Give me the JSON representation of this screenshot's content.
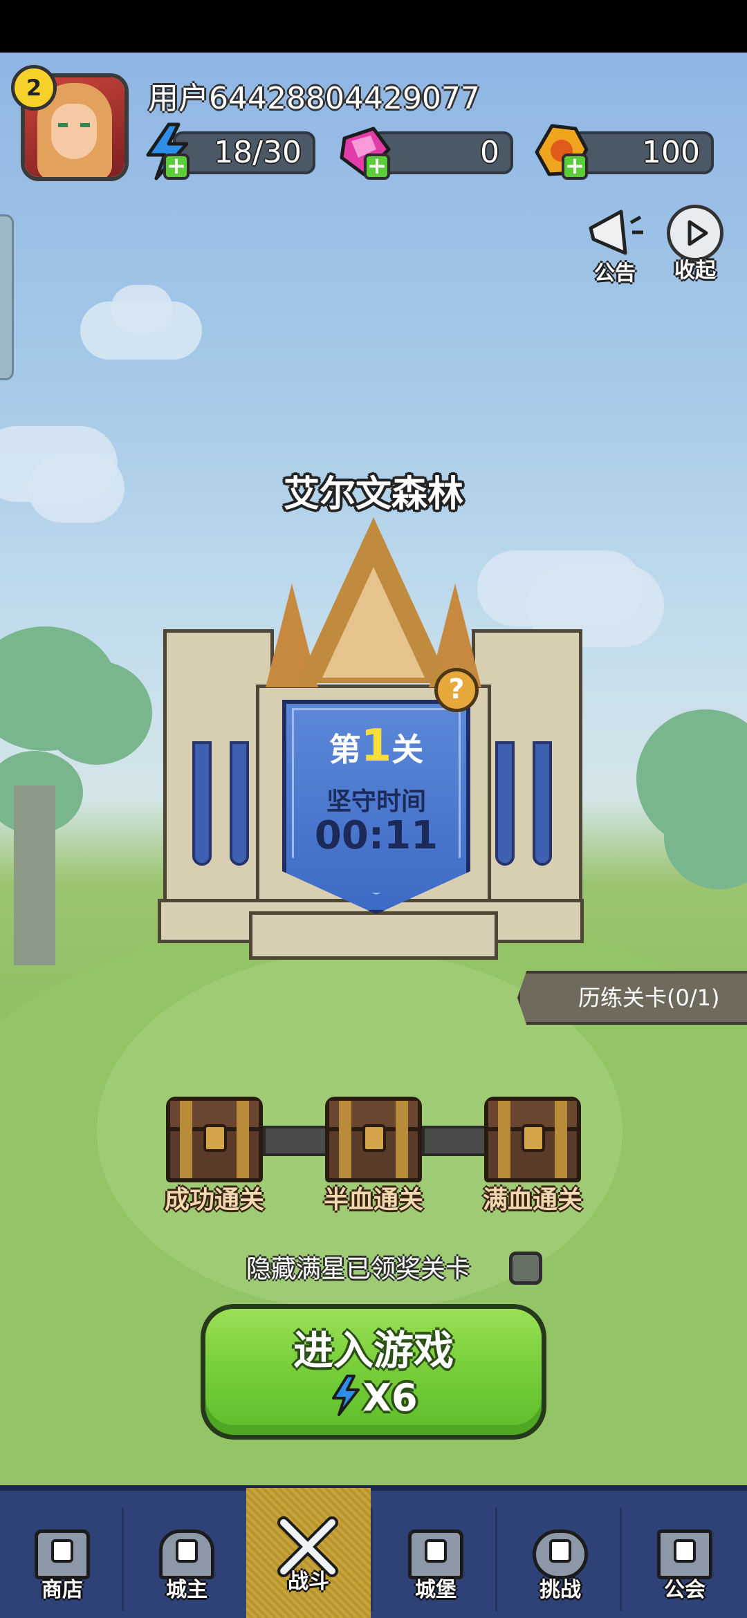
{
  "player": {
    "level": "2",
    "username": "用户64428804429077"
  },
  "resources": {
    "energy": "18/30",
    "gems": "0",
    "gold": "100"
  },
  "top_buttons": {
    "announcement": "公告",
    "collapse": "收起"
  },
  "stage": {
    "name": "艾尔文森林",
    "level_prefix": "第",
    "level_number": "1",
    "level_suffix": "关",
    "defend_label": "坚守时间",
    "defend_time": "00:11",
    "help": "?"
  },
  "trial_tab": "历练关卡(0/1)",
  "chests": [
    {
      "label": "成功通关"
    },
    {
      "label": "半血通关"
    },
    {
      "label": "满血通关"
    }
  ],
  "hide_completed": {
    "label": "隐藏满星已领奖关卡",
    "checked": false
  },
  "enter_button": {
    "label": "进入游戏",
    "cost": "X6"
  },
  "bottom_nav": [
    {
      "label": "商店",
      "locked": true,
      "active": false
    },
    {
      "label": "城主",
      "locked": true,
      "active": false
    },
    {
      "label": "战斗",
      "locked": false,
      "active": true
    },
    {
      "label": "城堡",
      "locked": true,
      "active": false
    },
    {
      "label": "挑战",
      "locked": true,
      "active": false
    },
    {
      "label": "公会",
      "locked": true,
      "active": false
    }
  ],
  "colors": {
    "energy_icon": "#2f8fe8",
    "gem_icon": "#e23ca8",
    "gold_icon": "#f0a51e",
    "enter_button": "#79cf3a",
    "nav_bg": "#2f4278",
    "nav_active": "#c8a53a"
  }
}
